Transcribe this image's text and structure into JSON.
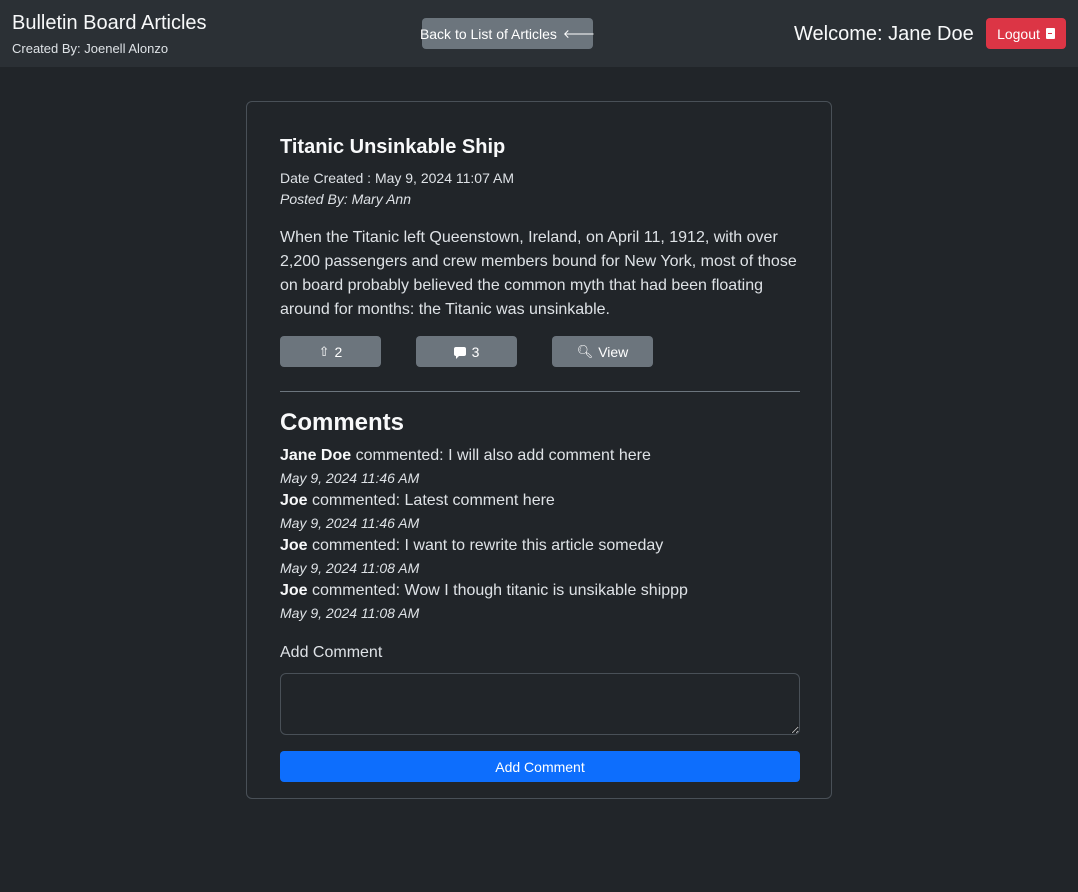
{
  "header": {
    "title": "Bulletin Board Articles",
    "subtitle": "Created By: Joenell Alonzo",
    "back_label": "Back to List of Articles",
    "welcome": "Welcome: Jane Doe",
    "logout_label": "Logout"
  },
  "article": {
    "title": "Titanic Unsinkable Ship",
    "date_created": "Date Created : May 9, 2024 11:07 AM",
    "posted_by": "Posted By: Mary Ann",
    "body": "When the Titanic left Queenstown, Ireland, on April 11, 1912, with over 2,200 passengers and crew members bound for New York, most of those on board probably believed the common myth that had been floating around for months: the Titanic was unsinkable.",
    "upvotes": "2",
    "comment_count": "3",
    "view_label": "View"
  },
  "comments_section": {
    "heading": "Comments",
    "verb": " commented: ",
    "items": [
      {
        "author": "Jane Doe",
        "text": "I will also add comment here",
        "time": "May 9, 2024 11:46 AM"
      },
      {
        "author": "Joe",
        "text": "Latest comment here",
        "time": "May 9, 2024 11:46 AM"
      },
      {
        "author": "Joe",
        "text": "I want to rewrite this article someday",
        "time": "May 9, 2024 11:08 AM"
      },
      {
        "author": "Joe",
        "text": "Wow I though titanic is unsikable shippp",
        "time": "May 9, 2024 11:08 AM"
      }
    ],
    "add_label": "Add Comment",
    "textarea_value": "",
    "add_button": "Add Comment"
  },
  "colors": {
    "background": "#212529",
    "navbar": "#2b3035",
    "secondary_button": "#6c757d",
    "danger_button": "#dc3545",
    "primary_button": "#0d6efd"
  }
}
